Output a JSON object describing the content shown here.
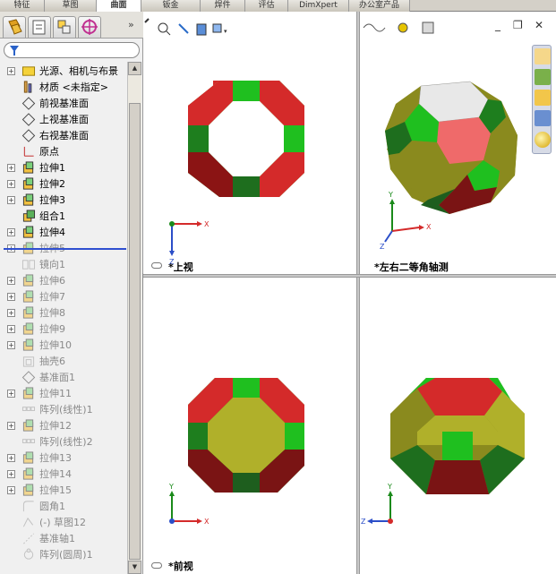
{
  "command_tabs": [
    "特征",
    "草图",
    "曲面",
    "钣金",
    "焊件",
    "评估",
    "DimXpert",
    "办公室产品"
  ],
  "active_command_tab": "曲面",
  "window_controls": {
    "minimize": "_",
    "restore": "❐",
    "close": "✕"
  },
  "feature_tree": {
    "items": [
      {
        "label": "光源、相机与布景",
        "icon": "lights-cameras-icon",
        "expander": true,
        "suppressed": false
      },
      {
        "label": "材质 <未指定>",
        "icon": "material-icon",
        "expander": false,
        "suppressed": false
      },
      {
        "label": "前视基准面",
        "icon": "plane-icon",
        "expander": false,
        "suppressed": false
      },
      {
        "label": "上视基准面",
        "icon": "plane-icon",
        "expander": false,
        "suppressed": false
      },
      {
        "label": "右视基准面",
        "icon": "plane-icon",
        "expander": false,
        "suppressed": false
      },
      {
        "label": "原点",
        "icon": "origin-icon",
        "expander": false,
        "suppressed": false
      },
      {
        "label": "拉伸1",
        "icon": "extrude-icon",
        "expander": true,
        "suppressed": false
      },
      {
        "label": "拉伸2",
        "icon": "extrude-icon",
        "expander": true,
        "suppressed": false
      },
      {
        "label": "拉伸3",
        "icon": "extrude-icon",
        "expander": true,
        "suppressed": false
      },
      {
        "label": "组合1",
        "icon": "combine-icon",
        "expander": false,
        "suppressed": false
      },
      {
        "label": "拉伸4",
        "icon": "extrude-icon",
        "expander": true,
        "suppressed": false
      },
      {
        "label": "拉伸5",
        "icon": "extrude-icon",
        "expander": true,
        "suppressed": true
      },
      {
        "label": "镜向1",
        "icon": "mirror-icon",
        "expander": false,
        "suppressed": true
      },
      {
        "label": "拉伸6",
        "icon": "extrude-icon",
        "expander": true,
        "suppressed": true
      },
      {
        "label": "拉伸7",
        "icon": "extrude-icon",
        "expander": true,
        "suppressed": true
      },
      {
        "label": "拉伸8",
        "icon": "extrude-icon",
        "expander": true,
        "suppressed": true
      },
      {
        "label": "拉伸9",
        "icon": "extrude-icon",
        "expander": true,
        "suppressed": true
      },
      {
        "label": "拉伸10",
        "icon": "extrude-icon",
        "expander": true,
        "suppressed": true
      },
      {
        "label": "抽壳6",
        "icon": "shell-icon",
        "expander": false,
        "suppressed": true
      },
      {
        "label": "基准面1",
        "icon": "plane-icon",
        "expander": false,
        "suppressed": true
      },
      {
        "label": "拉伸11",
        "icon": "extrude-icon",
        "expander": true,
        "suppressed": true
      },
      {
        "label": "阵列(线性)1",
        "icon": "linear-pattern-icon",
        "expander": false,
        "suppressed": true
      },
      {
        "label": "拉伸12",
        "icon": "extrude-icon",
        "expander": true,
        "suppressed": true
      },
      {
        "label": "阵列(线性)2",
        "icon": "linear-pattern-icon",
        "expander": false,
        "suppressed": true
      },
      {
        "label": "拉伸13",
        "icon": "extrude-icon",
        "expander": true,
        "suppressed": true
      },
      {
        "label": "拉伸14",
        "icon": "extrude-icon",
        "expander": true,
        "suppressed": true
      },
      {
        "label": "拉伸15",
        "icon": "extrude-icon",
        "expander": true,
        "suppressed": true
      },
      {
        "label": "圆角1",
        "icon": "fillet-icon",
        "expander": false,
        "suppressed": true
      },
      {
        "label": "(-) 草图12",
        "icon": "sketch-icon",
        "expander": false,
        "suppressed": true
      },
      {
        "label": "基准轴1",
        "icon": "axis-icon",
        "expander": false,
        "suppressed": true
      },
      {
        "label": "阵列(圆周)1",
        "icon": "circular-pattern-icon",
        "expander": false,
        "suppressed": true
      }
    ]
  },
  "viewports": {
    "top": {
      "label": "*上视"
    },
    "iso": {
      "label": "*左右二等角轴测"
    },
    "front": {
      "label": "*前视"
    },
    "right": {
      "label": ""
    }
  },
  "triad_axes": {
    "top": [
      "X",
      "Z"
    ],
    "iso": [
      "Y",
      "X",
      "Z"
    ],
    "front": [
      "Y",
      "X"
    ],
    "right": [
      "Y",
      "Z"
    ]
  },
  "colors": {
    "red": "#d42a2a",
    "dark_red": "#7a1414",
    "green": "#1fbf1f",
    "dark_green": "#1e6e1e",
    "olive": "#8a8a1e",
    "olive_light": "#b0b02a",
    "pink": "#ef6a6a",
    "light_grey": "#e8e8e8"
  }
}
